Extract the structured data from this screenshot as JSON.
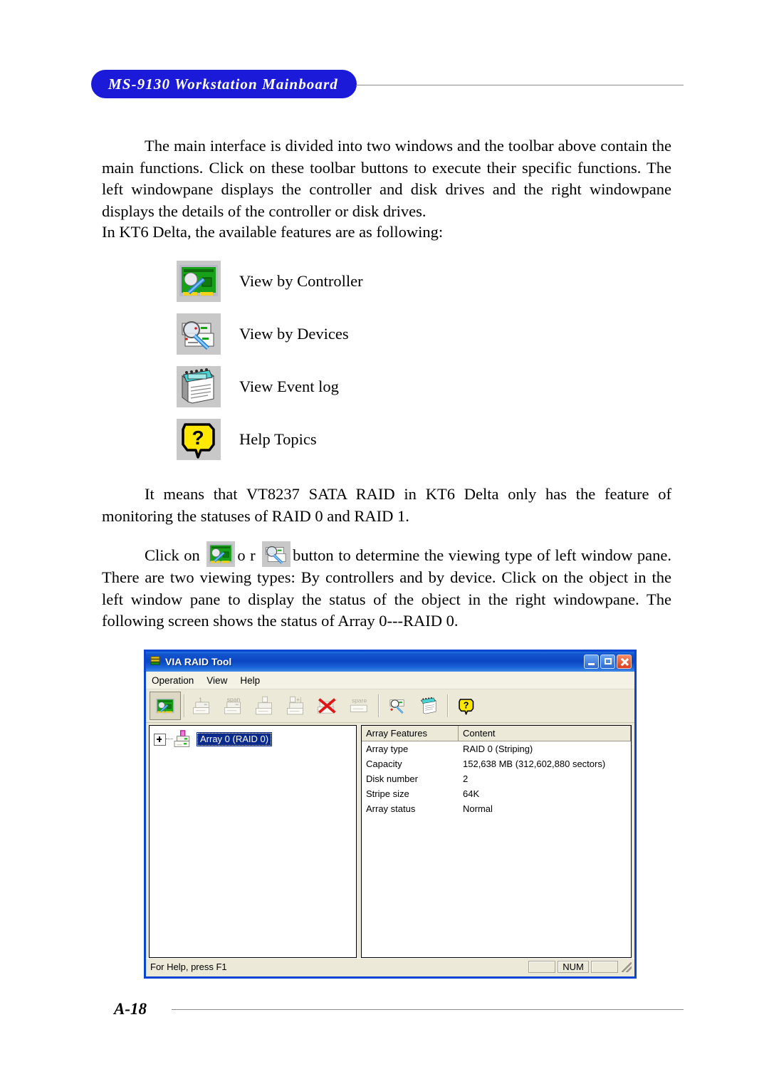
{
  "header": {
    "title": "MS-9130 Workstation Mainboard"
  },
  "body": {
    "paragraph1": "The main interface is divided into two windows and the toolbar above contain the main functions. Click on these toolbar buttons to execute their specific functions.  The left windowpane displays the controller and disk drives and the right windowpane displays the details of the controller or disk drives.",
    "paragraph1_tail": "In KT6 Delta, the available features are as following:",
    "paragraph2": "It means that VT8237 SATA RAID in KT6 Delta only has the feature of monitoring the statuses of RAID 0 and RAID 1.",
    "paragraph3_a": "Click on",
    "paragraph3_or": "o  r",
    "paragraph3_b": "button to determine the viewing type of left window pane. There are two viewing types: By controllers and by device.  Click on the object in the left window pane to display the status of the object in the right windowpane. The following screen shows the status of Array 0---RAID 0."
  },
  "features": [
    {
      "icon": "view-by-controller-icon",
      "label": "View by Controller"
    },
    {
      "icon": "view-by-devices-icon",
      "label": "View by Devices"
    },
    {
      "icon": "view-event-log-icon",
      "label": "View Event log"
    },
    {
      "icon": "help-topics-icon",
      "label": "Help Topics"
    }
  ],
  "window": {
    "title": "VIA RAID Tool",
    "buttons": {
      "minimize": "Minimize",
      "maximize": "Maximize",
      "close": "Close"
    },
    "menu": [
      "Operation",
      "View",
      "Help"
    ],
    "toolbar": [
      {
        "name": "view-by-controller-button",
        "label": "",
        "state": "pressed"
      },
      {
        "name": "create-raid0-button",
        "label": "1",
        "state": "disabled"
      },
      {
        "name": "create-span-button",
        "label": "span",
        "state": "disabled"
      },
      {
        "name": "create-raid1-button",
        "label": "",
        "state": "disabled"
      },
      {
        "name": "create-raid01-button",
        "label": "",
        "state": "disabled"
      },
      {
        "name": "delete-array-button",
        "label": "",
        "state": "disabled"
      },
      {
        "name": "create-spare-button",
        "label": "spare",
        "state": "disabled"
      },
      {
        "name": "view-by-devices-button",
        "label": "",
        "state": "enabled"
      },
      {
        "name": "view-event-log-button",
        "label": "",
        "state": "enabled"
      },
      {
        "name": "help-topics-button",
        "label": "",
        "state": "enabled"
      }
    ],
    "tree": {
      "node_label": "Array 0 (RAID 0)"
    },
    "details": {
      "columns": [
        "Array Features",
        "Content"
      ],
      "rows": [
        [
          "Array type",
          "RAID 0 (Striping)"
        ],
        [
          "Capacity",
          "152,638 MB (312,602,880 sectors)"
        ],
        [
          "Disk number",
          "2"
        ],
        [
          "Stripe size",
          "64K"
        ],
        [
          "Array status",
          "Normal"
        ]
      ]
    },
    "statusbar": {
      "hint": "For Help, press F1",
      "num": "NUM"
    }
  },
  "footer": {
    "page": "A-18"
  },
  "colors": {
    "header_pill": "#1a1ad8",
    "titlebar_blue": "#0b45c2",
    "selection_blue": "#0a2a8c",
    "close_red": "#d93d1c",
    "help_yellow": "#ffe800",
    "board_green": "#1a8f1a"
  }
}
